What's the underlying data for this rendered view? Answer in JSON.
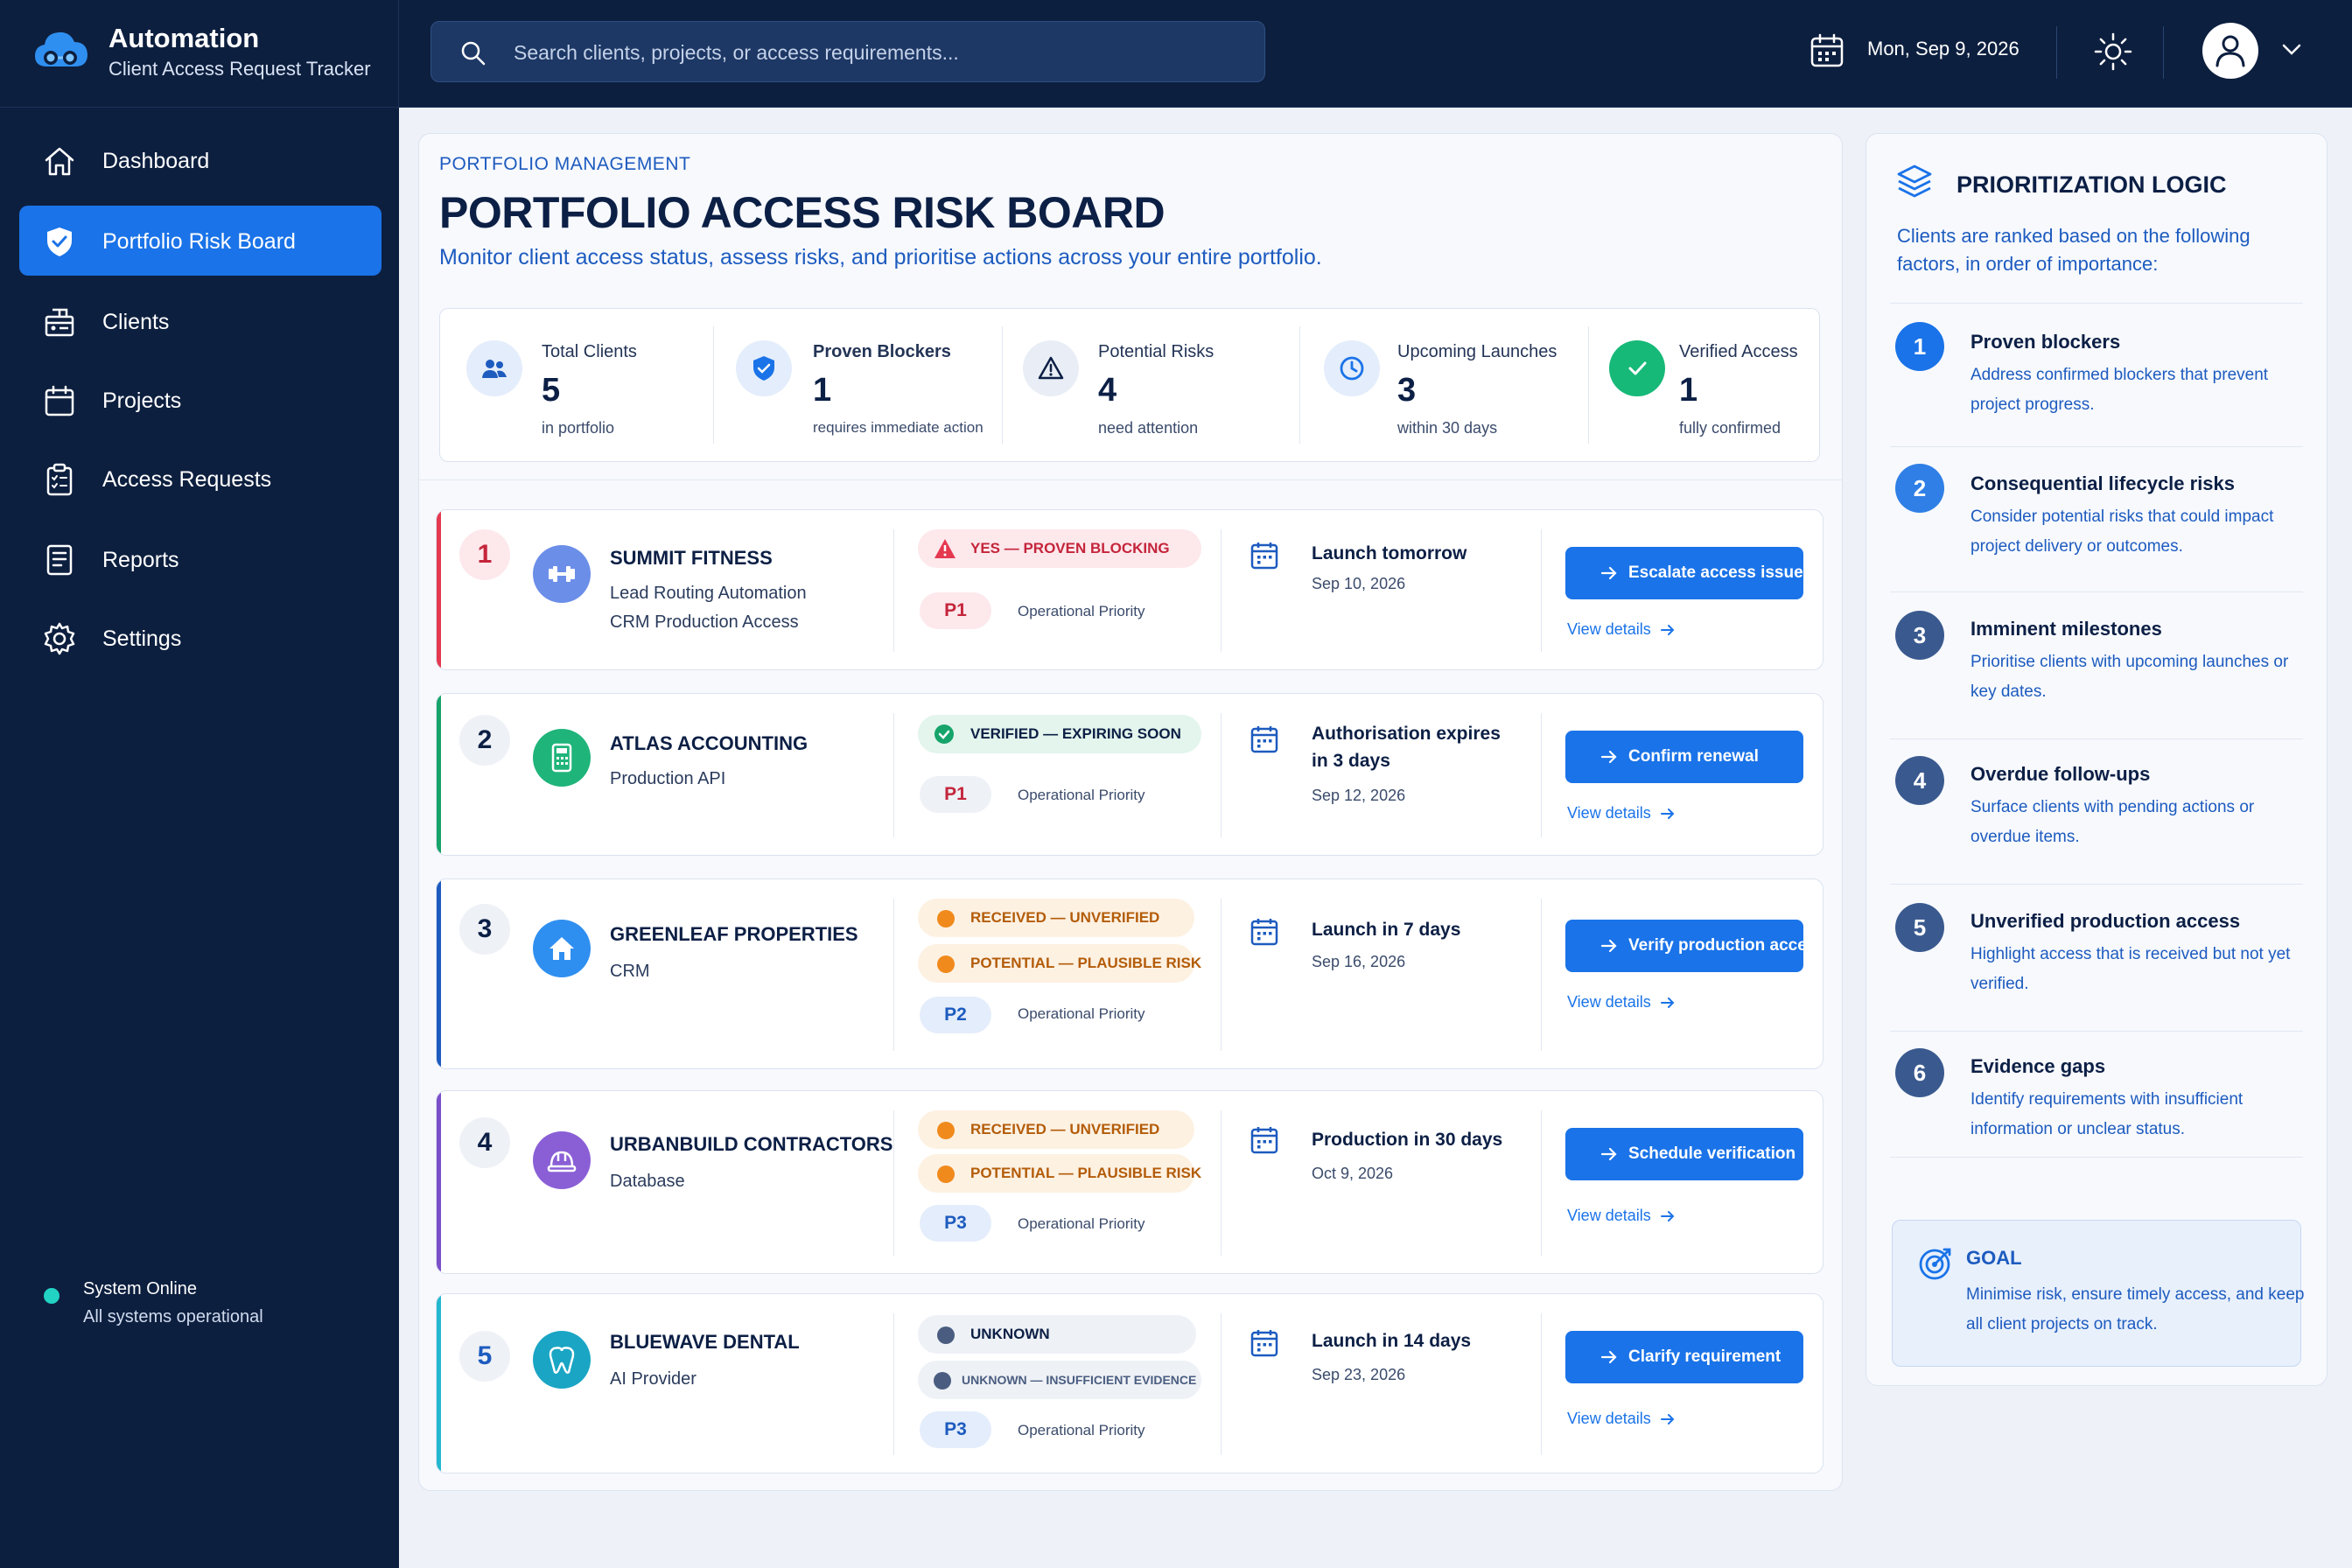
{
  "app": {
    "name": "Automation",
    "subtitle": "Client Access Request Tracker"
  },
  "search": {
    "placeholder": "Search clients, projects, or access requirements..."
  },
  "topbar": {
    "date": "Mon, Sep 9, 2026"
  },
  "sidebar": {
    "items": [
      {
        "label": "Dashboard",
        "icon": "home-icon"
      },
      {
        "label": "Portfolio Risk Board",
        "icon": "shield-icon",
        "active": true
      },
      {
        "label": "Clients",
        "icon": "clients-icon"
      },
      {
        "label": "Projects",
        "icon": "calendar-icon"
      },
      {
        "label": "Access Requests",
        "icon": "clipboard-icon"
      },
      {
        "label": "Reports",
        "icon": "document-icon"
      },
      {
        "label": "Settings",
        "icon": "gear-icon"
      }
    ],
    "status": {
      "title": "System Online",
      "subtitle": "All systems operational"
    }
  },
  "header": {
    "eyebrow": "PORTFOLIO MANAGEMENT",
    "title": "PORTFOLIO ACCESS RISK BOARD",
    "subtitle": "Monitor client access status, assess risks, and prioritise actions across your entire portfolio."
  },
  "stats": [
    {
      "label": "Total Clients",
      "value": "5",
      "note": "in portfolio"
    },
    {
      "label": "Proven Blockers",
      "value": "1",
      "note": "requires immediate action"
    },
    {
      "label": "Potential Risks",
      "value": "4",
      "note": "need attention"
    },
    {
      "label": "Upcoming Launches",
      "value": "3",
      "note": "within 30 days"
    },
    {
      "label": "Verified Access",
      "value": "1",
      "note": "fully confirmed"
    }
  ],
  "clients": [
    {
      "rank": "1",
      "name": "SUMMIT FITNESS",
      "lines": [
        "Lead Routing Automation",
        "CRM Production Access"
      ],
      "statuses": [
        "YES — PROVEN BLOCKING"
      ],
      "priority": "P1",
      "priority_label": "Operational Priority",
      "timing": "Launch tomorrow",
      "date": "Sep 10, 2026",
      "action": "Escalate access issue",
      "link": "View details"
    },
    {
      "rank": "2",
      "name": "ATLAS ACCOUNTING",
      "lines": [
        "Production API"
      ],
      "statuses": [
        "VERIFIED — EXPIRING SOON"
      ],
      "priority": "P1",
      "priority_label": "Operational Priority",
      "timing": "Authorisation expires in 3 days",
      "date": "Sep 12, 2026",
      "action": "Confirm renewal",
      "link": "View details"
    },
    {
      "rank": "3",
      "name": "GREENLEAF PROPERTIES",
      "lines": [
        "CRM"
      ],
      "statuses": [
        "RECEIVED — UNVERIFIED",
        "POTENTIAL — PLAUSIBLE RISK"
      ],
      "priority": "P2",
      "priority_label": "Operational Priority",
      "timing": "Launch in 7 days",
      "date": "Sep 16, 2026",
      "action": "Verify production access",
      "link": "View details"
    },
    {
      "rank": "4",
      "name": "URBANBUILD CONTRACTORS",
      "lines": [
        "Database"
      ],
      "statuses": [
        "RECEIVED — UNVERIFIED",
        "POTENTIAL — PLAUSIBLE RISK"
      ],
      "priority": "P3",
      "priority_label": "Operational Priority",
      "timing": "Production in 30 days",
      "date": "Oct 9, 2026",
      "action": "Schedule verification",
      "link": "View details"
    },
    {
      "rank": "5",
      "name": "BLUEWAVE DENTAL",
      "lines": [
        "AI Provider"
      ],
      "statuses": [
        "UNKNOWN",
        "UNKNOWN — INSUFFICIENT EVIDENCE"
      ],
      "priority": "P3",
      "priority_label": "Operational Priority",
      "timing": "Launch in 14 days",
      "date": "Sep 23, 2026",
      "action": "Clarify requirement",
      "link": "View details"
    }
  ],
  "prioritization": {
    "title": "PRIORITIZATION LOGIC",
    "intro": "Clients are ranked based on the following factors, in order of importance:",
    "factors": [
      {
        "num": "1",
        "title": "Proven blockers",
        "desc": "Address confirmed blockers that prevent project progress."
      },
      {
        "num": "2",
        "title": "Consequential lifecycle risks",
        "desc": "Consider potential risks that could impact project delivery or outcomes."
      },
      {
        "num": "3",
        "title": "Imminent milestones",
        "desc": "Prioritise clients with upcoming launches or key dates."
      },
      {
        "num": "4",
        "title": "Overdue follow-ups",
        "desc": "Surface clients with pending actions or overdue items."
      },
      {
        "num": "5",
        "title": "Unverified production access",
        "desc": "Highlight access that is received but not yet verified."
      },
      {
        "num": "6",
        "title": "Evidence gaps",
        "desc": "Identify requirements with insufficient information or unclear status."
      }
    ],
    "goal": {
      "title": "GOAL",
      "text": "Minimise risk, ensure timely access, and keep all client projects on track."
    }
  },
  "colors": {
    "sidebar_bg": "#0d1f3f",
    "accent": "#1a73e8",
    "blocker_red": "#e53950",
    "verified_green": "#16a46b",
    "unverified_orange": "#f08a1c",
    "unknown_slate": "#4a5d80"
  }
}
